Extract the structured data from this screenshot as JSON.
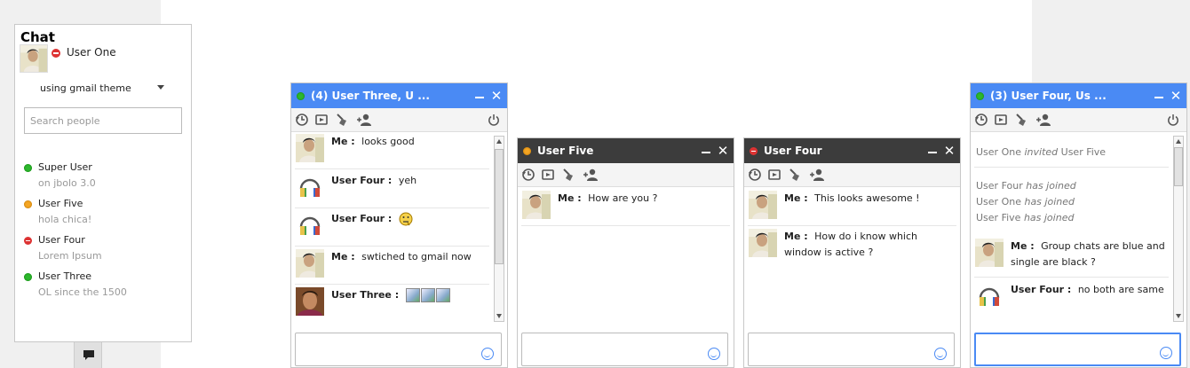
{
  "buddylist": {
    "title": "Chat",
    "user_name": "User One",
    "theme_label": "using gmail theme",
    "search_placeholder": "Search people",
    "contacts": [
      {
        "name": "Super User",
        "status_msg": "on jbolo 3.0",
        "status": "green"
      },
      {
        "name": "User Five",
        "status_msg": "hola chica!",
        "status": "orange"
      },
      {
        "name": "User Four",
        "status_msg": "Lorem Ipsum",
        "status": "red"
      },
      {
        "name": "User Three",
        "status_msg": "OL since the 1500",
        "status": "green"
      }
    ]
  },
  "windows": [
    {
      "title": "(4) User Three, U ...",
      "style": "blue",
      "status": "green",
      "messages": [
        {
          "sender": "Me :",
          "text": "looks good",
          "avatar": "photo"
        },
        {
          "sender": "User Four :",
          "text": "yeh",
          "avatar": "headphones"
        },
        {
          "sender": "User Four :",
          "text": "",
          "avatar": "headphones",
          "emoji": "thinking-emoji"
        },
        {
          "sender": "Me :",
          "text": "swtiched to gmail now",
          "avatar": "photo"
        },
        {
          "sender": "User Three :",
          "text": "",
          "avatar": "photo2",
          "images": 3
        }
      ]
    },
    {
      "title": "User Five",
      "style": "dark",
      "status": "orange",
      "messages": [
        {
          "sender": "Me :",
          "text": "How are you ?",
          "avatar": "photo"
        }
      ]
    },
    {
      "title": "User Four",
      "style": "dark",
      "status": "red",
      "messages": [
        {
          "sender": "Me :",
          "text": "This looks awesome !",
          "avatar": "photo"
        },
        {
          "sender": "Me :",
          "text": "How do i know which window is active ?",
          "avatar": "photo"
        }
      ]
    },
    {
      "title": "(3) User Four, Us ...",
      "style": "blue",
      "status": "green",
      "system": [
        {
          "actor": "User One",
          "action": "invited",
          "target": "User Five"
        },
        {
          "actor": "User Four",
          "action": "has joined"
        },
        {
          "actor": "User One",
          "action": "has joined"
        },
        {
          "actor": "User Five",
          "action": "has joined"
        }
      ],
      "messages": [
        {
          "sender": "Me :",
          "text": "Group chats are blue and single are black ?",
          "avatar": "photo"
        },
        {
          "sender": "User Four :",
          "text": "no both are same",
          "avatar": "headphones"
        }
      ]
    }
  ],
  "icons": {
    "history": "history-icon",
    "video": "video-icon",
    "clear": "broom-icon",
    "add_user": "add-user-icon",
    "power": "power-icon",
    "smiley": "smiley-icon"
  },
  "colors": {
    "group_header": "#4a8af4",
    "single_header": "#3c3c3c",
    "online": "#2eb82e",
    "away": "#f5a623",
    "busy": "#dd3333"
  }
}
